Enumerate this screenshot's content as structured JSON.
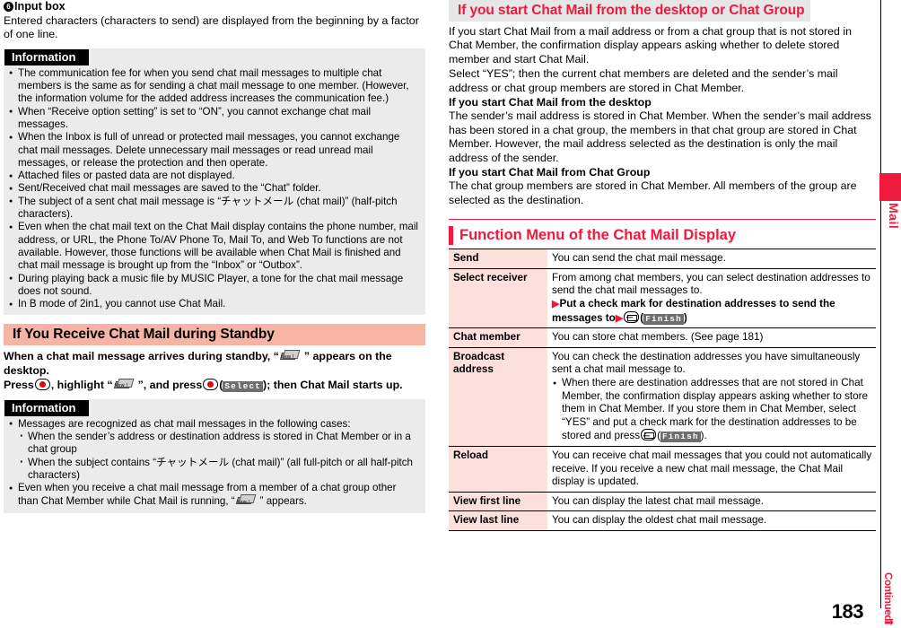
{
  "page": {
    "number": "183",
    "continued_label": "Continued",
    "continued_arrow": "➡",
    "side_tab_label": "Mail"
  },
  "left_column": {
    "input_box_heading": {
      "marker": "6",
      "text": "Input box"
    },
    "input_box_para": "Entered characters (characters to send) are displayed from the beginning by a factor of one line.",
    "information_1": {
      "title": "Information",
      "items": [
        "The communication fee for when you send chat mail messages to multiple chat members is the same as for sending a chat mail message to one member. (However, the information volume for the added address increases the communication fee.)",
        "When “Receive option setting” is set to “ON”, you cannot exchange chat mail messages.",
        "When the Inbox is full of unread or protected mail messages, you cannot exchange chat mail messages. Delete unnecessary mail messages or read unread mail messages, or release the protection and then operate.",
        "Attached files or pasted data are not displayed.",
        "Sent/Received chat mail messages are saved to the “Chat” folder.",
        "The subject of a sent chat mail message is “チャットメール (chat mail)” (half-pitch characters).",
        "Even when the chat mail text on the Chat Mail display contains the phone number, mail address, or URL, the Phone To/AV Phone To, Mail To, and Web To functions are not available. However, those functions will be available when Chat Mail is finished and chat mail message is brought up from the “Inbox” or “Outbox”.",
        "During playing back a music file by MUSIC Player, a tone for the chat mail message does not sound.",
        "In B mode of 2in1, you cannot use Chat Mail."
      ]
    },
    "standby_section": {
      "heading": "If You Receive Chat Mail during Standby",
      "line1_a": "When a chat mail message arrives during standby, “",
      "line1_b": "” appears on the desktop.",
      "line2_a": "Press",
      "line2_b": ", highlight “",
      "line2_c": "”, and press",
      "line2_d": "); then Chat Mail starts up.",
      "softkey_select": "Select"
    },
    "information_2": {
      "title": "Information",
      "item1": "Messages are recognized as chat mail messages in the following cases:",
      "subitems": [
        "When the sender’s address or destination address is stored in Chat Member or in a chat group",
        "When the subject contains “チャットメール (chat mail)” (all full-pitch or all half-pitch characters)"
      ],
      "item2_a": "Even when you receive a chat mail message from a member of a chat group other than Chat Member while Chat Mail is running, “",
      "item2_b": "” appears."
    },
    "icon_new_label": "New !"
  },
  "right_column": {
    "desktop_section": {
      "heading": "If you start Chat Mail from the desktop or Chat Group",
      "paras": [
        "If you start Chat Mail from a mail address or from a chat group that is not stored in Chat Member, the confirmation display appears asking whether to delete stored member and start Chat Mail.",
        "Select “YES”; then the current chat members are deleted and the sender’s mail address or chat group members are stored in Chat Member."
      ],
      "sub1_heading": "If you start Chat Mail from the desktop",
      "sub1_para": "The sender’s mail address is stored in Chat Member. When the sender’s mail address has been stored in a chat group, the members in that chat group are stored in Chat Member. However, the mail address selected as the destination is only the mail address of the sender.",
      "sub2_heading": "If you start Chat Mail from Chat Group",
      "sub2_para": "The chat group members are stored in Chat Member. All members of the group are selected as the destination."
    },
    "function_menu": {
      "heading": "Function Menu of the Chat Mail Display",
      "rows": [
        {
          "key": "Send",
          "lines": [
            "You can send the chat mail message."
          ]
        },
        {
          "key": "Select receiver",
          "lines": [
            "From among chat members, you can select destination addresses to send the chat mail messages to."
          ],
          "step_a": "Put a check mark for destination addresses to send the messages to",
          "step_b": ")"
        },
        {
          "key": "Chat member",
          "lines": [
            "You can store chat members. (See page 181)"
          ]
        },
        {
          "key": "Broadcast address",
          "lines": [
            "You can check the destination addresses you have simultaneously sent a chat mail message to."
          ],
          "bullet_a": "When there are destination addresses that are not stored in Chat Member, the confirmation display appears asking whether to store them in Chat Member. If you store them in Chat Member, select “YES” and put a check mark for the destination addresses to be stored and press",
          "bullet_b": ")."
        },
        {
          "key": "Reload",
          "lines": [
            "You can receive chat mail messages that you could not automatically receive. If you receive a new chat mail message, the Chat Mail display is updated."
          ]
        },
        {
          "key": "View first line",
          "lines": [
            "You can display the latest chat mail message."
          ]
        },
        {
          "key": "View last line",
          "lines": [
            "You can display the oldest chat mail message."
          ]
        }
      ],
      "softkey_finish": "Finish",
      "triangle": "▶"
    }
  },
  "colors": {
    "brand_red": "#ed1a3d",
    "pink_band": "#f7b3a4",
    "table_key_bg": "#fbe0db",
    "info_bg": "#ebebeb",
    "grey_band": "#e6e6e6"
  }
}
